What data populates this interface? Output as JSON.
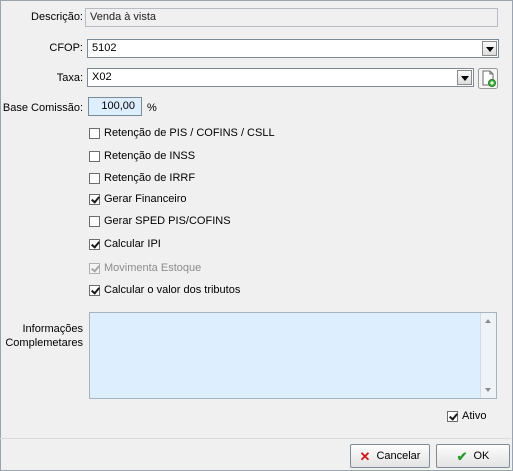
{
  "labels": {
    "descricao": "Descrição:",
    "cfop": "CFOP:",
    "taxa": "Taxa:",
    "base_comissao": "Base Comissão:",
    "informacoes_line1": "Informações",
    "informacoes_line2": "Complemetares",
    "percent": "%"
  },
  "fields": {
    "descricao": "Venda à vista",
    "cfop": "5102",
    "taxa": "X02",
    "base_comissao": "100,00",
    "informacoes": ""
  },
  "checkboxes": [
    {
      "label": "Retenção de PIS / COFINS / CSLL",
      "checked": false,
      "enabled": true
    },
    {
      "label": "Retenção de INSS",
      "checked": false,
      "enabled": true
    },
    {
      "label": "Retenção de IRRF",
      "checked": false,
      "enabled": true
    },
    {
      "label": "Gerar Financeiro",
      "checked": true,
      "enabled": true
    },
    {
      "label": "Gerar SPED PIS/COFINS",
      "checked": false,
      "enabled": true
    },
    {
      "label": "Calcular IPI",
      "checked": true,
      "enabled": true
    },
    {
      "label": "Movimenta Estoque",
      "checked": true,
      "enabled": false
    },
    {
      "label": "Calcular o valor dos tributos",
      "checked": true,
      "enabled": true
    }
  ],
  "ativo": {
    "label": "Ativo",
    "checked": true
  },
  "buttons": {
    "cancel": "Cancelar",
    "ok": "OK"
  },
  "colors": {
    "cancel_icon": "#d01818",
    "ok_icon": "#2e9a2e",
    "input_blue": "#ddeeff"
  },
  "icons": {
    "new_document": "new-document-icon",
    "cancel": "x-icon",
    "ok": "checkmark-icon"
  }
}
